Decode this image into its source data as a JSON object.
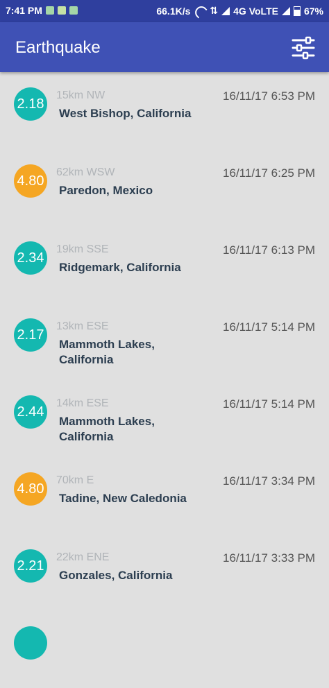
{
  "status_bar": {
    "time": "7:41 PM",
    "speed": "66.1K/s",
    "network": "4G VoLTE",
    "battery": "67%"
  },
  "app_bar": {
    "title": "Earthquake"
  },
  "colors": {
    "primary": "#3f51b5",
    "status": "#2f3f9e",
    "teal": "#14b8b0",
    "orange": "#f5a623"
  },
  "quakes": [
    {
      "mag": "2.18",
      "offset": "15km NW",
      "place": "West Bishop, California",
      "time": "16/11/17 6:53 PM",
      "color": "#14b8b0"
    },
    {
      "mag": "4.80",
      "offset": "62km WSW",
      "place": "Paredon, Mexico",
      "time": "16/11/17 6:25 PM",
      "color": "#f5a623"
    },
    {
      "mag": "2.34",
      "offset": "19km SSE",
      "place": "Ridgemark, California",
      "time": "16/11/17 6:13 PM",
      "color": "#14b8b0"
    },
    {
      "mag": "2.17",
      "offset": "13km ESE",
      "place": "Mammoth Lakes, California",
      "time": "16/11/17 5:14 PM",
      "color": "#14b8b0"
    },
    {
      "mag": "2.44",
      "offset": "14km ESE",
      "place": "Mammoth Lakes, California",
      "time": "16/11/17 5:14 PM",
      "color": "#14b8b0"
    },
    {
      "mag": "4.80",
      "offset": "70km E",
      "place": "Tadine, New Caledonia",
      "time": "16/11/17 3:34 PM",
      "color": "#f5a623"
    },
    {
      "mag": "2.21",
      "offset": "22km ENE",
      "place": "Gonzales, California",
      "time": "16/11/17 3:33 PM",
      "color": "#14b8b0"
    },
    {
      "mag": "",
      "offset": "",
      "place": "",
      "time": "",
      "color": "#14b8b0"
    }
  ]
}
